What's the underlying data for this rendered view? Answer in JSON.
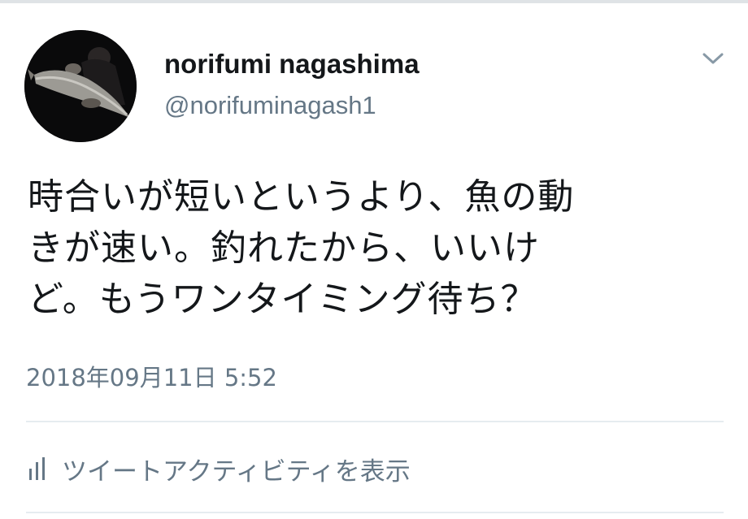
{
  "tweet": {
    "author": {
      "display_name": "norifumi nagashima",
      "handle": "@norifuminagash1",
      "avatar_icon": "fishing-photo-avatar"
    },
    "menu_icon": "chevron-down-icon",
    "text_lines": [
      "時合いが短いというより、魚の動",
      "きが速い。釣れたから、いいけ",
      "ど。もうワンタイミング待ち？"
    ],
    "timestamp": "2018年09月11日 5:52",
    "activity": {
      "label": "ツイートアクティビティを表示",
      "icon": "bar-chart-icon"
    }
  },
  "colors": {
    "text_primary": "#14171a",
    "text_secondary": "#657786",
    "divider": "#e6ecf0",
    "background": "#ffffff"
  }
}
